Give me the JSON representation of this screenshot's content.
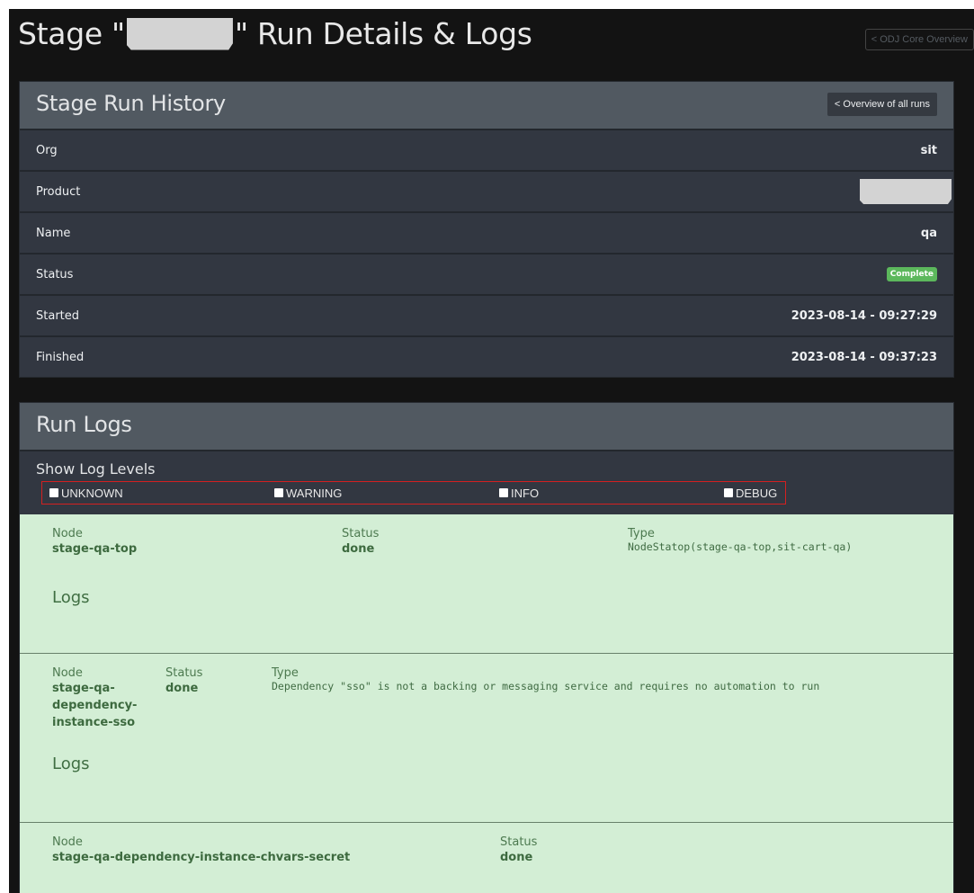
{
  "header": {
    "title_prefix": "Stage \"",
    "title_suffix": "\" Run Details & Logs",
    "core_button": "< ODJ Core Overview"
  },
  "history": {
    "title": "Stage Run History",
    "overview_button": "< Overview of all runs",
    "rows": [
      {
        "label": "Org",
        "value": "sit"
      },
      {
        "label": "Product",
        "value": ""
      },
      {
        "label": "Name",
        "value": "qa"
      },
      {
        "label": "Status",
        "value": "Complete"
      },
      {
        "label": "Started",
        "value": "2023-08-14 - 09:27:29"
      },
      {
        "label": "Finished",
        "value": "2023-08-14 - 09:37:23"
      }
    ]
  },
  "logs": {
    "title": "Run Logs",
    "filter_label": "Show Log Levels",
    "levels": [
      {
        "label": "UNKNOWN",
        "checked": false
      },
      {
        "label": "WARNING",
        "checked": false
      },
      {
        "label": "INFO",
        "checked": false
      },
      {
        "label": "DEBUG",
        "checked": false
      }
    ],
    "col_labels": {
      "node": "Node",
      "status": "Status",
      "type": "Type",
      "logs": "Logs"
    },
    "nodes": [
      {
        "node": "stage-qa-top",
        "status": "done",
        "type": "NodeStatop(stage-qa-top,sit-cart-qa)"
      },
      {
        "node": "stage-qa-dependency-instance-sso",
        "node_lines": [
          "stage-qa-",
          "dependency-",
          "instance-sso"
        ],
        "status": "done",
        "type": "Dependency \"sso\" is not a backing or messaging service and requires no automation to run"
      },
      {
        "node": "stage-qa-dependency-instance-chvars-secret",
        "status": "done",
        "type": ""
      }
    ]
  },
  "colors": {
    "background": "#131313",
    "panel_head": "#515961",
    "panel_body": "#323741",
    "success": "#5cb85c",
    "node_bg": "#d3eed5",
    "filter_border": "#d42020"
  }
}
